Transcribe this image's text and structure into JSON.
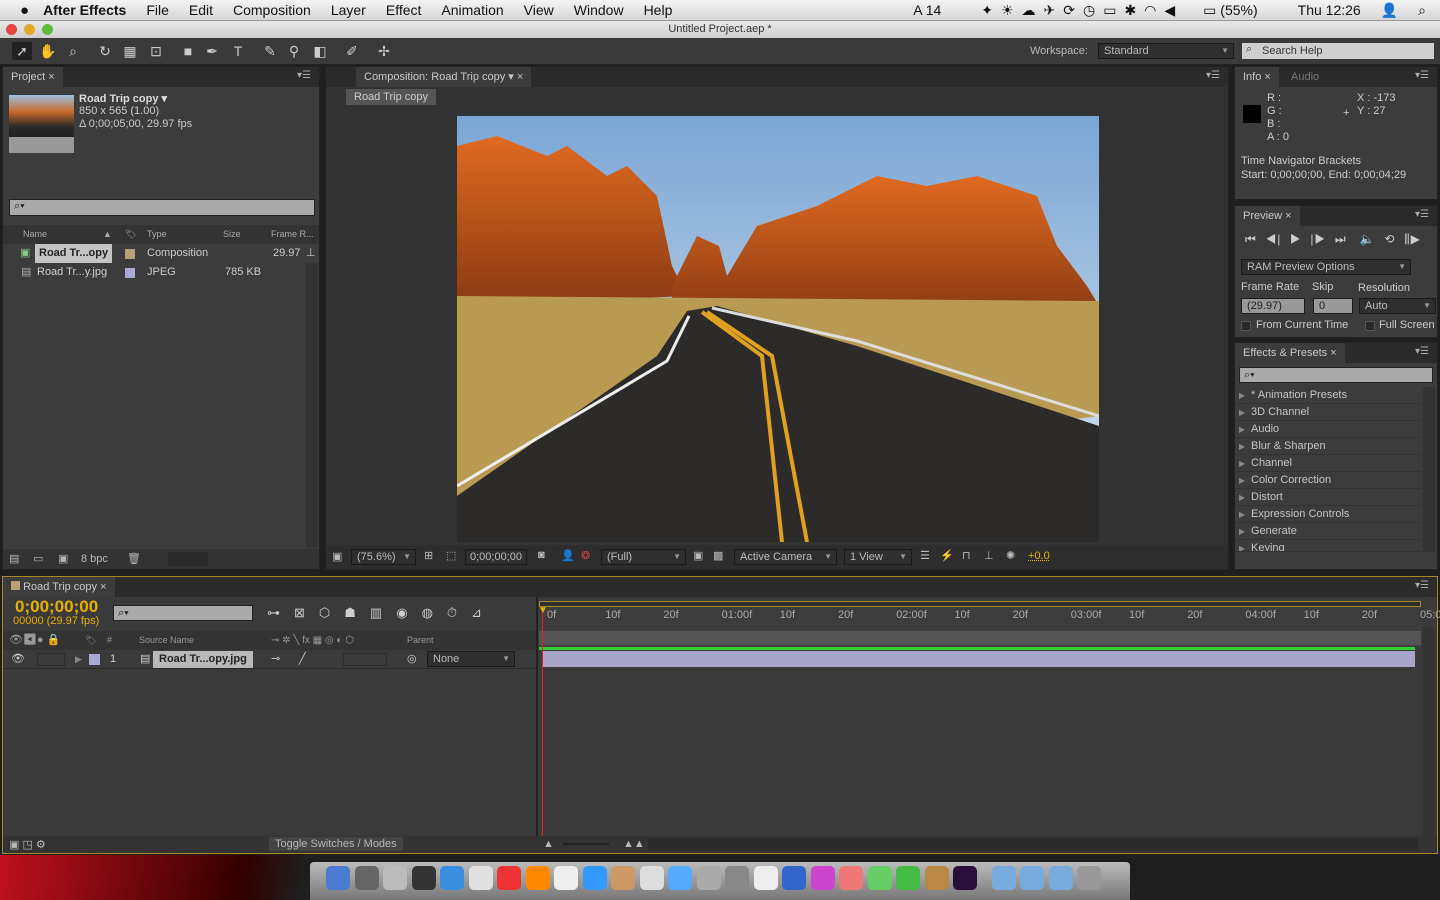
{
  "menubar": {
    "app": "After Effects",
    "items": [
      "File",
      "Edit",
      "Composition",
      "Layer",
      "Effect",
      "Animation",
      "View",
      "Window",
      "Help"
    ],
    "status": {
      "adobe": "14",
      "battery": "(55%)",
      "clock": "Thu 12:26"
    }
  },
  "window": {
    "title": "Untitled Project.aep *"
  },
  "toolbar": {
    "workspace_label": "Workspace:",
    "workspace_value": "Standard",
    "search_help": "Search Help"
  },
  "project": {
    "tab": "Project",
    "comp_name": "Road Trip copy ▾",
    "dims": "850 x 565 (1.00)",
    "duration": "Δ 0;00;05;00, 29.97 fps",
    "columns": [
      "Name",
      "Type",
      "Size",
      "Frame R..."
    ],
    "rows": [
      {
        "name": "Road Tr...opy",
        "type": "Composition",
        "size": "",
        "fr": "29.97",
        "label_color": "#b7a07a"
      },
      {
        "name": "Road Tr...y.jpg",
        "type": "JPEG",
        "size": "785 KB",
        "fr": "",
        "label_color": "#a9a9d6"
      }
    ],
    "bpc": "8 bpc"
  },
  "composition": {
    "tab": "Composition: Road Trip copy",
    "subtab": "Road Trip copy",
    "zoom": "(75.6%)",
    "timecode": "0;00;00;00",
    "resolution": "(Full)",
    "camera": "Active Camera",
    "views": "1 View",
    "exposure": "+0.0"
  },
  "info": {
    "tab": "Info",
    "tab2": "Audio",
    "r": "R :",
    "g": "G :",
    "b": "B :",
    "a": "A : 0",
    "x": "X : -173",
    "y": "Y : 27",
    "nav_title": "Time Navigator Brackets",
    "nav_range": "Start: 0;00;00;00, End: 0;00;04;29"
  },
  "preview": {
    "tab": "Preview",
    "ram": "RAM Preview Options",
    "frame_rate_label": "Frame Rate",
    "skip_label": "Skip",
    "resolution_label": "Resolution",
    "frame_rate": "(29.97)",
    "skip": "0",
    "resolution": "Auto",
    "from_current": "From Current Time",
    "full_screen": "Full Screen"
  },
  "effects": {
    "tab": "Effects & Presets",
    "items": [
      "* Animation Presets",
      "3D Channel",
      "Audio",
      "Blur & Sharpen",
      "Channel",
      "Color Correction",
      "Distort",
      "Expression Controls",
      "Generate",
      "Keying"
    ]
  },
  "timeline": {
    "tab": "Road Trip copy",
    "timecode": "0;00;00;00",
    "frames": "00000 (29.97 fps)",
    "col_source": "Source Name",
    "col_parent": "Parent",
    "col_num": "#",
    "layer": {
      "num": "1",
      "name": "Road Tr...opy.jpg",
      "parent": "None"
    },
    "ruler": [
      "0f",
      "10f",
      "20f",
      "01:00f",
      "10f",
      "20f",
      "02:00f",
      "10f",
      "20f",
      "03:00f",
      "10f",
      "20f",
      "04:00f",
      "10f",
      "20f",
      "05:0"
    ],
    "toggle": "Toggle Switches / Modes"
  },
  "colors": {
    "accent": "#e8b100",
    "layer_bar": "#a7a6c9",
    "playhead": "#d22"
  }
}
